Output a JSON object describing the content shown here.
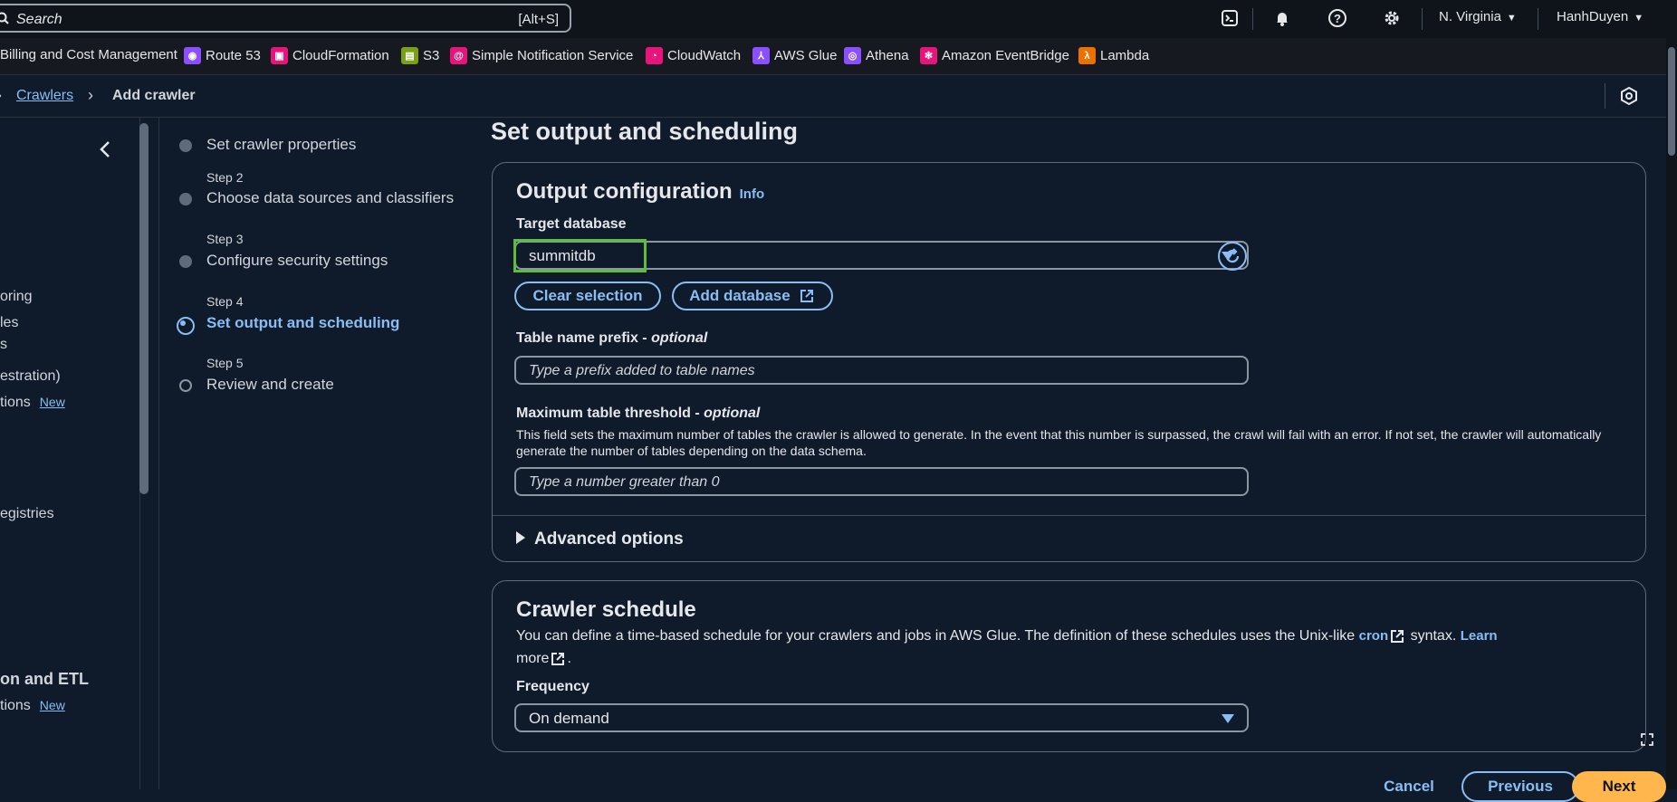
{
  "topbar": {
    "search_placeholder": "Search",
    "search_shortcut": "[Alt+S]",
    "region": "N. Virginia",
    "user": "HanhDuyen"
  },
  "favorites": [
    {
      "label": "Billing and Cost Management",
      "color": "#16191f",
      "icon": ""
    },
    {
      "label": "Route 53",
      "color": "#8c4fff",
      "icon": "route53-icon"
    },
    {
      "label": "CloudFormation",
      "color": "#e7157b",
      "icon": "cloudformation-icon"
    },
    {
      "label": "S3",
      "color": "#7aa116",
      "icon": "s3-icon"
    },
    {
      "label": "Simple Notification Service",
      "color": "#e7157b",
      "icon": "sns-icon"
    },
    {
      "label": "CloudWatch",
      "color": "#e7157b",
      "icon": "cloudwatch-icon"
    },
    {
      "label": "AWS Glue",
      "color": "#8c4fff",
      "icon": "glue-icon"
    },
    {
      "label": "Athena",
      "color": "#8c4fff",
      "icon": "athena-icon"
    },
    {
      "label": "Amazon EventBridge",
      "color": "#e7157b",
      "icon": "eventbridge-icon"
    },
    {
      "label": "Lambda",
      "color": "#ed7100",
      "icon": "lambda-icon"
    }
  ],
  "breadcrumb": {
    "link": "Crawlers",
    "current": "Add crawler"
  },
  "leftnav": {
    "frag1": "oring",
    "frag2": "les",
    "frag3": "s",
    "frag4": "estration)",
    "frag5": "tions",
    "frag5_badge": "New",
    "frag6": "egistries",
    "section": "on and ETL",
    "frag7": "tions",
    "frag7_badge": "New"
  },
  "steps": [
    {
      "num": "",
      "title": "Set crawler properties",
      "state": "done"
    },
    {
      "num": "Step 2",
      "title": "Choose data sources and classifiers",
      "state": "done"
    },
    {
      "num": "Step 3",
      "title": "Configure security settings",
      "state": "done"
    },
    {
      "num": "Step 4",
      "title": "Set output and scheduling",
      "state": "current"
    },
    {
      "num": "Step 5",
      "title": "Review and create",
      "state": "pending"
    }
  ],
  "main": {
    "page_title": "Set output and scheduling",
    "output": {
      "title": "Output configuration",
      "info": "Info",
      "target_db_label": "Target database",
      "target_db_value": "summitdb",
      "clear_selection": "Clear selection",
      "add_database": "Add database",
      "prefix_label": "Table name prefix - ",
      "prefix_optional": "optional",
      "prefix_placeholder": "Type a prefix added to table names",
      "threshold_label": "Maximum table threshold - ",
      "threshold_optional": "optional",
      "threshold_desc": "This field sets the maximum number of tables the crawler is allowed to generate. In the event that this number is surpassed, the crawl will fail with an error. If not set, the crawler will automatically generate the number of tables depending on the data schema.",
      "threshold_placeholder": "Type a number greater than 0",
      "advanced": "Advanced options"
    },
    "schedule": {
      "title": "Crawler schedule",
      "desc_part1": "You can define a time-based schedule for your crawlers and jobs in AWS Glue. The definition of these schedules uses the Unix-like",
      "cron_link": "cron",
      "desc_part2": "syntax.",
      "learn_more_1": "Learn",
      "learn_more_2": "more",
      "frequency_label": "Frequency",
      "frequency_value": "On demand"
    }
  },
  "footer": {
    "cancel": "Cancel",
    "previous": "Previous",
    "next": "Next"
  },
  "colors": {
    "accent": "#89bdf3",
    "highlight": "#5bbf3b",
    "primary_button": "#ffb74d"
  }
}
